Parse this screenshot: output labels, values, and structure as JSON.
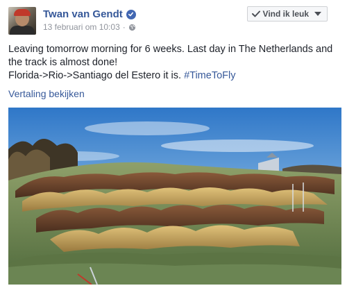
{
  "post": {
    "author": "Twan van Gendt",
    "timestamp": "13 februari om 10:03",
    "meta_separator": "·",
    "text_line1": "Leaving tomorrow morning for 6 weeks. Last day in The Netherlands and",
    "text_line2": "the track is almost done!",
    "text_line3": "Florida->Rio->Santiago del Estero it is. ",
    "hashtag": "#TimeToFly",
    "translate_link": "Vertaling bekijken"
  },
  "like_button": {
    "label": "Vind ik leuk",
    "icon": "check-icon",
    "dropdown_icon": "caret-down-icon"
  },
  "colors": {
    "link": "#365899",
    "text": "#1d2129",
    "meta": "#90949c",
    "verified": "#4267b2"
  }
}
